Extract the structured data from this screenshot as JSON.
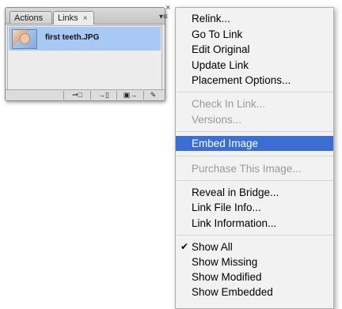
{
  "panel": {
    "tabs": [
      {
        "label": "Actions"
      },
      {
        "label": "Links",
        "close": "×"
      }
    ],
    "close_glyph": "×",
    "menu_glyph": "▾≡",
    "rows": [
      {
        "label": "first teeth.JPG"
      }
    ],
    "footer_buttons": [
      {
        "glyph": "⇀□"
      },
      {
        "glyph": "→▯"
      },
      {
        "glyph": "▣→"
      },
      {
        "glyph": "✎"
      }
    ]
  },
  "menu": {
    "items": [
      {
        "label": "Relink...",
        "state": "enabled"
      },
      {
        "label": "Go To Link",
        "state": "enabled"
      },
      {
        "label": "Edit Original",
        "state": "enabled"
      },
      {
        "label": "Update Link",
        "state": "enabled"
      },
      {
        "label": "Placement Options...",
        "state": "enabled"
      },
      {
        "label": "Check In Link...",
        "state": "disabled"
      },
      {
        "label": "Versions...",
        "state": "disabled"
      },
      {
        "label": "Embed Image",
        "state": "selected"
      },
      {
        "label": "Purchase This Image...",
        "state": "disabled"
      },
      {
        "label": "Reveal in Bridge...",
        "state": "enabled"
      },
      {
        "label": "Link File Info...",
        "state": "enabled"
      },
      {
        "label": "Link Information...",
        "state": "enabled"
      },
      {
        "label": "Show All",
        "state": "enabled",
        "checked": true,
        "check_glyph": "✔"
      },
      {
        "label": "Show Missing",
        "state": "enabled"
      },
      {
        "label": "Show Modified",
        "state": "enabled"
      },
      {
        "label": "Show Embedded",
        "state": "enabled"
      }
    ]
  }
}
